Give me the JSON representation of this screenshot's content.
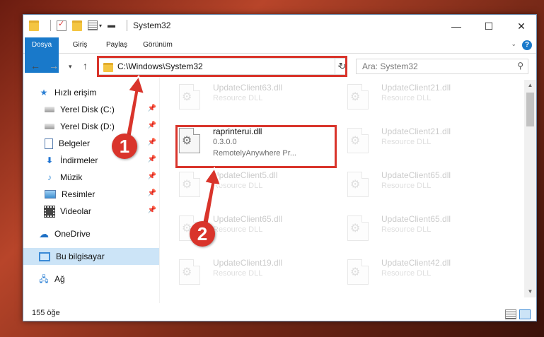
{
  "window": {
    "title": "System32",
    "close": "✕",
    "maximize": "☐",
    "minimize": "—"
  },
  "ribbon": {
    "tabs": [
      "Dosya",
      "Giriş",
      "Paylaş",
      "Görünüm"
    ],
    "help": "?"
  },
  "address": {
    "path": "C:\\Windows\\System32",
    "search_placeholder": "Ara: System32"
  },
  "nav": {
    "items": [
      {
        "label": "Hızlı erişim",
        "icon": "quick-access-star-icon",
        "pinned": false
      },
      {
        "label": "Yerel Disk (C:)",
        "icon": "drive-icon",
        "pinned": true
      },
      {
        "label": "Yerel Disk (D:)",
        "icon": "drive-icon",
        "pinned": true
      },
      {
        "label": "Belgeler",
        "icon": "documents-icon",
        "pinned": true
      },
      {
        "label": "İndirmeler",
        "icon": "downloads-icon",
        "pinned": true
      },
      {
        "label": "Müzik",
        "icon": "music-icon",
        "pinned": true
      },
      {
        "label": "Resimler",
        "icon": "pictures-icon",
        "pinned": true
      },
      {
        "label": "Videolar",
        "icon": "videos-icon",
        "pinned": true
      },
      {
        "label": "OneDrive",
        "icon": "onedrive-icon",
        "pinned": false
      },
      {
        "label": "Bu bilgisayar",
        "icon": "this-pc-icon",
        "pinned": false
      },
      {
        "label": "Ağ",
        "icon": "network-icon",
        "pinned": false
      }
    ]
  },
  "files": {
    "left": [
      {
        "name": "UpdateClient63.dll",
        "sub": "Resource DLL"
      },
      {
        "name": "raprinterui.dll",
        "version": "0.3.0.0",
        "company": "RemotelyAnywhere Pr..."
      },
      {
        "name": "UpdateClient5.dll",
        "sub": "Resource DLL"
      },
      {
        "name": "UpdateClient65.dll",
        "sub": "Resource DLL"
      },
      {
        "name": "UpdateClient19.dll",
        "sub": "Resource DLL"
      }
    ],
    "right": [
      {
        "name": "UpdateClient21.dll",
        "sub": "Resource DLL"
      },
      {
        "name": "UpdateClient21.dll",
        "sub": "Resource DLL"
      },
      {
        "name": "UpdateClient65.dll",
        "sub": "Resource DLL"
      },
      {
        "name": "UpdateClient65.dll",
        "sub": "Resource DLL"
      },
      {
        "name": "UpdateClient42.dll",
        "sub": "Resource DLL"
      }
    ]
  },
  "status": {
    "count": "155 öğe"
  },
  "annotations": {
    "badge1": "1",
    "badge2": "2"
  },
  "colors": {
    "accent": "#1979ca",
    "annotation_red": "#d9342b",
    "selection": "#cce4f7"
  }
}
